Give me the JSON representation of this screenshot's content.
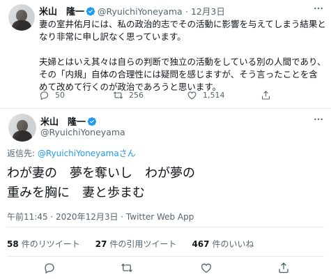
{
  "tweet1": {
    "name": "米山　隆一",
    "handle": "@RyuichiYoneyama",
    "separator": "·",
    "date": "12月3日",
    "more_icon": "more-icon",
    "body": "妻の室井佑月には、私の政治的志でその活動に影響を与えてしまう結果となり非常に申し訳なく思っています。\n\n夫婦とはいえ其々は自らの判断で独立の活動をしている別の人間であり、その「内規」自体の合理性には疑問を感じますが、そう言ったことを含めて改めて行くのが政治であろうと思います。",
    "replies": "50",
    "retweets": "256",
    "likes": "1,514"
  },
  "tweet2": {
    "name": "米山　隆一",
    "handle": "@RyuichiYoneyama",
    "reply_prefix": "返信先: ",
    "reply_mention": "@RyuichiYoneyamaさん",
    "text": "わが妻の　夢を奪いし　わが夢の\n重みを胸に　妻と歩まむ",
    "meta": "午前11:45 · 2020年12月3日 · Twitter Web App",
    "stats": {
      "retweets_count": "58",
      "retweets_label": "件のリツイート",
      "quotes_count": "27",
      "quotes_label": "件の引用ツイート",
      "likes_count": "467",
      "likes_label": "件のいいね"
    }
  },
  "colors": {
    "accent": "#1d9bf0",
    "text": "#0f1419",
    "secondary": "#536471",
    "divider": "#e6ecf0"
  }
}
